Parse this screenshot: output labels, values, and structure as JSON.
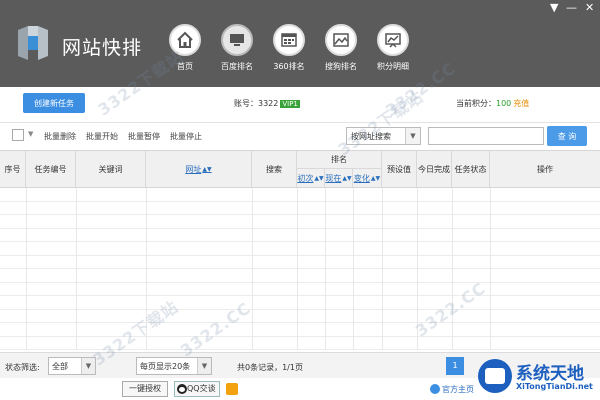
{
  "header": {
    "app_title": "网站快排",
    "window_controls": {
      "menu": "▼",
      "minimize": "—",
      "close": "✕"
    },
    "nav": [
      {
        "label": "首页",
        "icon": "home-icon"
      },
      {
        "label": "百度排名",
        "icon": "monitor-icon",
        "active": true
      },
      {
        "label": "360排名",
        "icon": "grid-window-icon"
      },
      {
        "label": "搜狗排名",
        "icon": "map-icon"
      },
      {
        "label": "积分明细",
        "icon": "chart-board-icon"
      }
    ]
  },
  "info": {
    "create_task": "创建新任务",
    "account_label": "账号：3322",
    "vip_badge": "VIP1",
    "points_label": "当前积分：",
    "points_value": "100",
    "recharge": "充值"
  },
  "toolbar": {
    "batch_delete": "批量删除",
    "batch_start": "批量开始",
    "batch_pause": "批量暂停",
    "batch_stop": "批量停止",
    "search_type": "按网址搜索",
    "search_placeholder": "",
    "query": "查 询"
  },
  "table": {
    "columns": {
      "index": "序号",
      "task_id": "任务编号",
      "keyword": "关键词",
      "url": "网址",
      "engine": "搜索",
      "rank": "排名",
      "rank_initial": "初次",
      "rank_current": "现在",
      "rank_change": "变化",
      "preset": "预设值",
      "today_done": "今日完成",
      "task_status": "任务状态",
      "action": "操作"
    },
    "rows": []
  },
  "statusbar": {
    "filter_label": "状态筛选:",
    "filter_value": "全部",
    "page_size": "每页显示20条",
    "records": "共0条记录，1/1页",
    "current_page": "1"
  },
  "bottom": {
    "one_click": "一键授权",
    "qq_chat": "QQ交谈",
    "home": "官方主页"
  },
  "brand": {
    "cn": "系统天地",
    "en": "XiTongTianDi.net"
  },
  "watermark": "3322下载站",
  "watermark_url": "3322.CC",
  "colors": {
    "header_bg": "#5b5b5b",
    "primary_blue": "#3b8ee2",
    "vip_green": "#39a339",
    "recharge_orange": "#e58a00"
  }
}
